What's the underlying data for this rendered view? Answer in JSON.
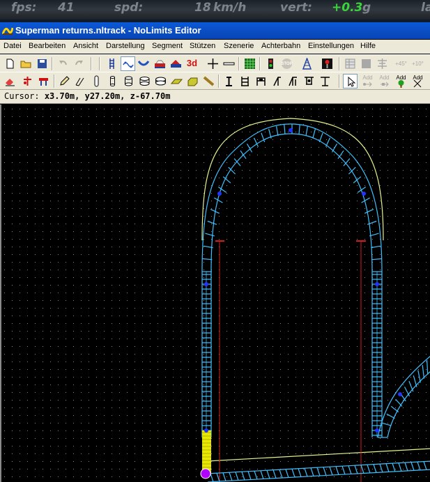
{
  "hud": {
    "fps_label": "fps:",
    "fps_value": "41",
    "spd_label": "spd:",
    "spd_value": "18",
    "spd_unit": "km/h",
    "vert_label": "vert:",
    "vert_value": "+0.3",
    "vert_unit": "g",
    "lat_label": "la"
  },
  "window": {
    "title": "Superman returns.nltrack - NoLimits Editor"
  },
  "menu": [
    "Datei",
    "Bearbeiten",
    "Ansicht",
    "Darstellung",
    "Segment",
    "Stützen",
    "Szenerie",
    "Achterbahn",
    "Einstellungen",
    "Hilfe"
  ],
  "toolbar": {
    "stop_label": "STOP",
    "threed_label": "3d",
    "add_label": "Add",
    "deg45_label": "+45°",
    "deg10_label": "+10°"
  },
  "status": {
    "cursor_label": "Cursor:",
    "cursor_value": "x3.70m, y27.20m, z-67.70m"
  },
  "colors": {
    "track": "#3fc1ff",
    "guide_curve": "#e6f28c",
    "support": "#d81c1c",
    "node": "#2233ff",
    "highlight": "#e8e800",
    "selected": "#b000ff"
  }
}
